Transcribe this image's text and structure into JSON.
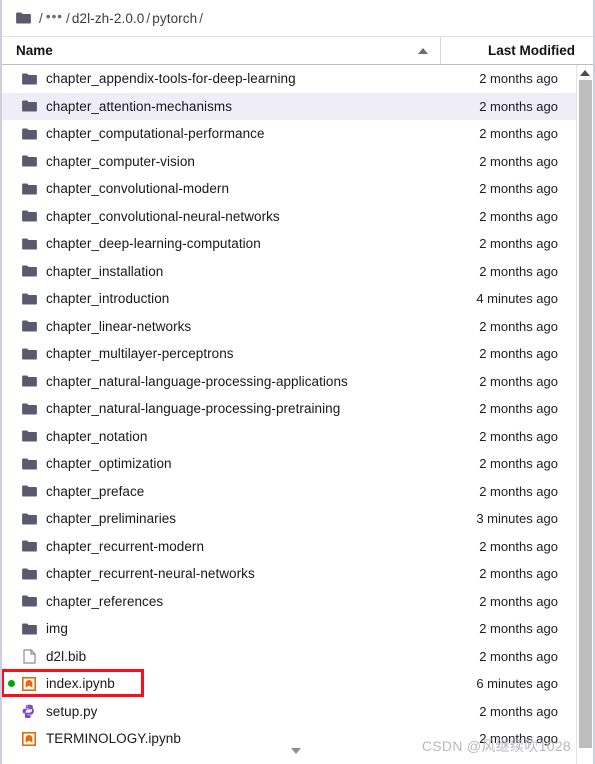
{
  "breadcrumb": {
    "folder_icon": "folder-icon",
    "segments": [
      "/",
      "…",
      "/",
      "d2l-zh-2.0.0",
      "/",
      "pytorch",
      "/"
    ],
    "root_sep": "/",
    "ellipsis": "•••",
    "sep": "/",
    "path1": "d2l-zh-2.0.0",
    "path2": "pytorch"
  },
  "columns": {
    "name": "Name",
    "last_modified": "Last Modified",
    "sort_icon": "sort-ascending-arrow-icon"
  },
  "colors": {
    "folder_icon": "#5a5a6e",
    "notebook_icon": "#e8690b",
    "python_icon": "#7c48c6",
    "file_icon": "#8b8b96",
    "kernel_running_dot": "#00a600",
    "selected_row_bg": "#efedf7",
    "highlight_box": "#fc0d1b",
    "scrollbar_thumb": "#bdbdbd"
  },
  "files": [
    {
      "name": "chapter_appendix-tools-for-deep-learning",
      "modified": "2 months ago",
      "icon": "folder-icon",
      "type": "folder",
      "selected": false,
      "running": false,
      "highlighted": false
    },
    {
      "name": "chapter_attention-mechanisms",
      "modified": "2 months ago",
      "icon": "folder-icon",
      "type": "folder",
      "selected": true,
      "running": false,
      "highlighted": false
    },
    {
      "name": "chapter_computational-performance",
      "modified": "2 months ago",
      "icon": "folder-icon",
      "type": "folder",
      "selected": false,
      "running": false,
      "highlighted": false
    },
    {
      "name": "chapter_computer-vision",
      "modified": "2 months ago",
      "icon": "folder-icon",
      "type": "folder",
      "selected": false,
      "running": false,
      "highlighted": false
    },
    {
      "name": "chapter_convolutional-modern",
      "modified": "2 months ago",
      "icon": "folder-icon",
      "type": "folder",
      "selected": false,
      "running": false,
      "highlighted": false
    },
    {
      "name": "chapter_convolutional-neural-networks",
      "modified": "2 months ago",
      "icon": "folder-icon",
      "type": "folder",
      "selected": false,
      "running": false,
      "highlighted": false
    },
    {
      "name": "chapter_deep-learning-computation",
      "modified": "2 months ago",
      "icon": "folder-icon",
      "type": "folder",
      "selected": false,
      "running": false,
      "highlighted": false
    },
    {
      "name": "chapter_installation",
      "modified": "2 months ago",
      "icon": "folder-icon",
      "type": "folder",
      "selected": false,
      "running": false,
      "highlighted": false
    },
    {
      "name": "chapter_introduction",
      "modified": "4 minutes ago",
      "icon": "folder-icon",
      "type": "folder",
      "selected": false,
      "running": false,
      "highlighted": false
    },
    {
      "name": "chapter_linear-networks",
      "modified": "2 months ago",
      "icon": "folder-icon",
      "type": "folder",
      "selected": false,
      "running": false,
      "highlighted": false
    },
    {
      "name": "chapter_multilayer-perceptrons",
      "modified": "2 months ago",
      "icon": "folder-icon",
      "type": "folder",
      "selected": false,
      "running": false,
      "highlighted": false
    },
    {
      "name": "chapter_natural-language-processing-applications",
      "modified": "2 months ago",
      "icon": "folder-icon",
      "type": "folder",
      "selected": false,
      "running": false,
      "highlighted": false
    },
    {
      "name": "chapter_natural-language-processing-pretraining",
      "modified": "2 months ago",
      "icon": "folder-icon",
      "type": "folder",
      "selected": false,
      "running": false,
      "highlighted": false
    },
    {
      "name": "chapter_notation",
      "modified": "2 months ago",
      "icon": "folder-icon",
      "type": "folder",
      "selected": false,
      "running": false,
      "highlighted": false
    },
    {
      "name": "chapter_optimization",
      "modified": "2 months ago",
      "icon": "folder-icon",
      "type": "folder",
      "selected": false,
      "running": false,
      "highlighted": false
    },
    {
      "name": "chapter_preface",
      "modified": "2 months ago",
      "icon": "folder-icon",
      "type": "folder",
      "selected": false,
      "running": false,
      "highlighted": false
    },
    {
      "name": "chapter_preliminaries",
      "modified": "3 minutes ago",
      "icon": "folder-icon",
      "type": "folder",
      "selected": false,
      "running": false,
      "highlighted": false
    },
    {
      "name": "chapter_recurrent-modern",
      "modified": "2 months ago",
      "icon": "folder-icon",
      "type": "folder",
      "selected": false,
      "running": false,
      "highlighted": false
    },
    {
      "name": "chapter_recurrent-neural-networks",
      "modified": "2 months ago",
      "icon": "folder-icon",
      "type": "folder",
      "selected": false,
      "running": false,
      "highlighted": false
    },
    {
      "name": "chapter_references",
      "modified": "2 months ago",
      "icon": "folder-icon",
      "type": "folder",
      "selected": false,
      "running": false,
      "highlighted": false
    },
    {
      "name": "img",
      "modified": "2 months ago",
      "icon": "folder-icon",
      "type": "folder",
      "selected": false,
      "running": false,
      "highlighted": false
    },
    {
      "name": "d2l.bib",
      "modified": "2 months ago",
      "icon": "file-icon",
      "type": "file",
      "selected": false,
      "running": false,
      "highlighted": false
    },
    {
      "name": "index.ipynb",
      "modified": "6 minutes ago",
      "icon": "notebook-icon",
      "type": "notebook",
      "selected": false,
      "running": true,
      "highlighted": true
    },
    {
      "name": "setup.py",
      "modified": "2 months ago",
      "icon": "python-icon",
      "type": "python",
      "selected": false,
      "running": false,
      "highlighted": false
    },
    {
      "name": "TERMINOLOGY.ipynb",
      "modified": "2 months ago",
      "icon": "notebook-icon",
      "type": "notebook",
      "selected": false,
      "running": false,
      "highlighted": false
    }
  ],
  "scrollbar": {
    "up_icon": "scroll-up-arrow-icon",
    "down_icon": "scroll-down-arrow-icon"
  },
  "watermark": {
    "text": "CSDN @风继续吹1028"
  }
}
